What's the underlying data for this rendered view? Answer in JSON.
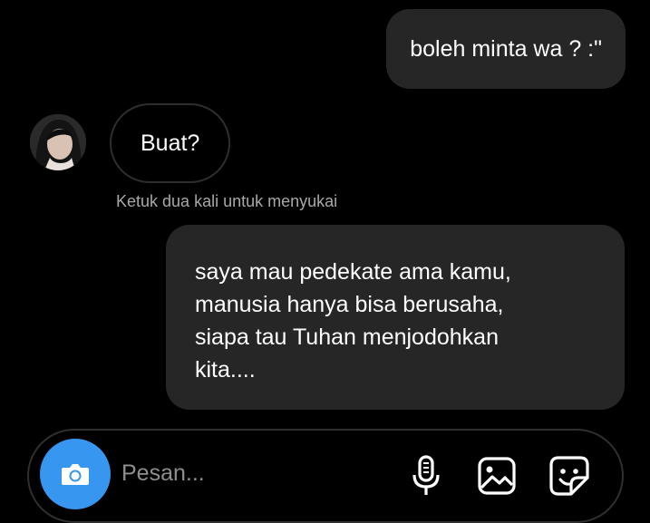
{
  "chat": {
    "messages": [
      {
        "sender": "me",
        "text": "boleh minta wa ? :\""
      },
      {
        "sender": "them",
        "text": "Buat?"
      },
      {
        "sender": "me",
        "text": "saya mau pedekate ama kamu,\nmanusia hanya bisa berusaha,\nsiapa tau Tuhan menjodohkan\nkita...."
      }
    ],
    "like_hint": "Ketuk dua kali untuk menyukai"
  },
  "composer": {
    "placeholder": "Pesan...",
    "icons": {
      "camera": "camera-icon",
      "mic": "microphone-icon",
      "gallery": "image-icon",
      "sticker": "sticker-icon"
    }
  },
  "colors": {
    "background": "#000000",
    "outgoing_bubble": "#262626",
    "camera_button": "#3797f0",
    "hint_text": "#a8a8a8"
  }
}
